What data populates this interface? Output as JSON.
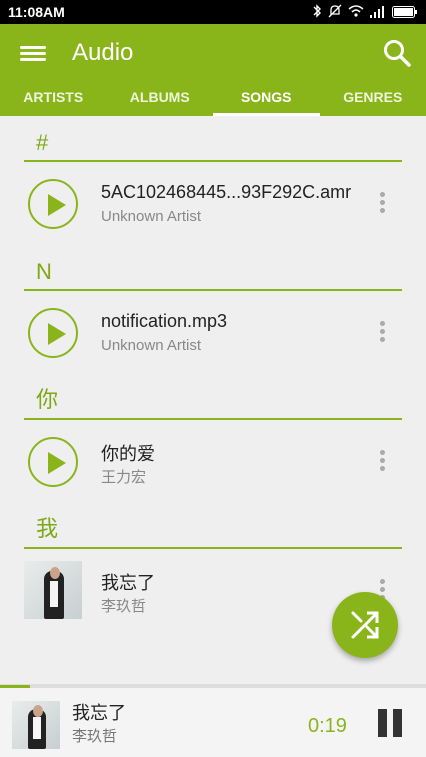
{
  "status_bar": {
    "time": "11:08AM"
  },
  "app_bar": {
    "title": "Audio",
    "tabs": [
      {
        "label": "ARTISTS"
      },
      {
        "label": "ALBUMS"
      },
      {
        "label": "SONGS",
        "active": true
      },
      {
        "label": "GENRES"
      }
    ]
  },
  "sections": [
    {
      "header": "#",
      "songs": [
        {
          "title": "5AC102468445...93F292C.amr",
          "artist": "Unknown Artist"
        }
      ]
    },
    {
      "header": "N",
      "songs": [
        {
          "title": "notification.mp3",
          "artist": "Unknown Artist"
        }
      ]
    },
    {
      "header": "你",
      "songs": [
        {
          "title": "你的爱",
          "artist": "王力宏"
        }
      ]
    },
    {
      "header": "我",
      "songs": [
        {
          "title": "我忘了",
          "artist": "李玖哲",
          "has_artwork": true
        }
      ]
    }
  ],
  "now_playing": {
    "title": "我忘了",
    "artist": "李玖哲",
    "elapsed": "0:19",
    "progress": 0.07
  },
  "colors": {
    "accent": "#8ab51a",
    "header_text": "#7ea815"
  }
}
